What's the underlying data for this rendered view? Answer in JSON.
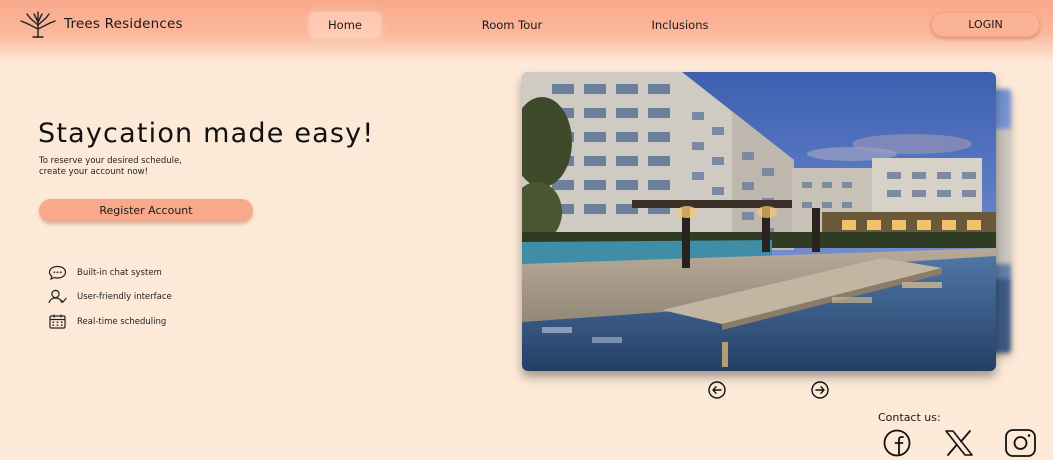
{
  "brand": {
    "name": "Trees Residences",
    "logo_icon": "tree-logo-icon"
  },
  "nav": {
    "home": "Home",
    "room_tour": "Room Tour",
    "inclusions": "Inclusions",
    "login": "LOGIN",
    "active": "Home"
  },
  "hero": {
    "headline": "Staycation made easy!",
    "subtext_line1": "To reserve your desired schedule,",
    "subtext_line2": "create your account now!",
    "register_label": "Register Account"
  },
  "features": [
    {
      "label": "Built-in chat system",
      "icon": "chat-icon"
    },
    {
      "label": "User-friendly interface",
      "icon": "user-icon"
    },
    {
      "label": "Real-time scheduling",
      "icon": "calendar-icon"
    }
  ],
  "carousel": {
    "image_alt": "Residences pool area at dusk",
    "prev_icon": "arrow-left-icon",
    "next_icon": "arrow-right-icon"
  },
  "contact": {
    "label": "Contact us:",
    "socials": [
      "facebook-icon",
      "x-icon",
      "instagram-icon"
    ]
  },
  "colors": {
    "background": "#fde9d7",
    "accent": "#f9a98b",
    "text": "#111111"
  }
}
